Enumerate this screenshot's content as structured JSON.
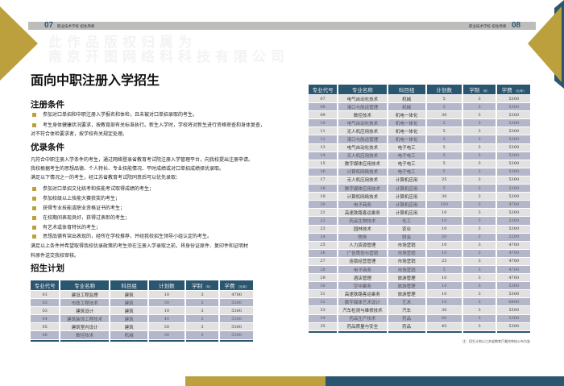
{
  "header": {
    "left_page": "07",
    "right_page": "08",
    "school": "职业技术学校  招生简章"
  },
  "watermark": [
    "此作品版权归属为",
    "南京开图网络科科技有限公司"
  ],
  "title": "面向中职注册入学招生",
  "registration": {
    "heading": "注册条件",
    "bullets": [
      "参加对口单招和中职注册入学报名和体检，且未被对口单招录取的考生。",
      "考生身体健康状况要求，按教育部有关标准执行。新生入学时，学校将对新生进行资格审查和身体复查，"
    ],
    "continuation": "对不符合体检要求者，按学校有关规定处理。"
  },
  "priority": {
    "heading": "优录条件",
    "intro": [
      "凡符合中职注册入学条件的考生，通过网络登录省教育考试院注册入学管理平台，向我校提出注册申请。",
      "我校根据考生的思想品德、个人特长、专业技能情况、平时成绩或对口单招成绩择优录取。",
      "满足以下情况之一的考生，经江苏省教育考试院同意后可以优先录取："
    ],
    "bullets": [
      "参加对口单招文化统考和技能考试取得成绩的考生；",
      "参加校级以上技能大赛获奖的考生；",
      "获得专业技能或职业资格证书的考生；",
      "在校期间表现良好，获得过表彰的考生；",
      "有艺术或体育特长的考生；",
      "思想品德有突出表现的，经所在学校推荐，并经我校招生领导小组认定的考生。"
    ],
    "closing": [
      "满足以上条件并希望取得我校优录政策的考生须在注册入学录取之前，将身份证原件、复印件和证明材",
      "料原件送交我校审核。"
    ]
  },
  "plan": {
    "heading": "招生计划"
  },
  "table_headers": [
    "专业代号",
    "专业名称",
    "科目组",
    "计划数",
    "学制",
    "学费"
  ],
  "table_header_units": [
    "",
    "",
    "",
    "",
    "（年）",
    "（元/年）"
  ],
  "table_left": [
    [
      "01",
      "建设工程监理",
      "建筑",
      "10",
      "3",
      "4700"
    ],
    [
      "02",
      "市政工程技术",
      "建筑",
      "30",
      "3",
      "5300"
    ],
    [
      "03",
      "建筑设计",
      "建筑",
      "10",
      "3",
      "5300"
    ],
    [
      "04",
      "建筑装饰工程技术",
      "建筑",
      "40",
      "3",
      "5300"
    ],
    [
      "05",
      "建筑室内设计",
      "建筑",
      "30",
      "3",
      "5300"
    ],
    [
      "06",
      "数控技术",
      "机械",
      "30",
      "3",
      "5300"
    ]
  ],
  "table_right": [
    [
      "07",
      "电气自动化技术",
      "机械",
      "5",
      "3",
      "5300"
    ],
    [
      "08",
      "港口与航运管理",
      "机械",
      "5",
      "3",
      "5300"
    ],
    [
      "09",
      "数控技术",
      "机电一体化",
      "30",
      "3",
      "5300"
    ],
    [
      "10",
      "电气自动化技术",
      "机电一体化",
      "5",
      "3",
      "5300"
    ],
    [
      "11",
      "无人机应用技术",
      "机电一体化",
      "5",
      "3",
      "5300"
    ],
    [
      "12",
      "港口与航运管理",
      "机电一体化",
      "5",
      "3",
      "5300"
    ],
    [
      "13",
      "电气自动化技术",
      "电子电工",
      "5",
      "3",
      "5300"
    ],
    [
      "14",
      "无人机应用技术",
      "电子电工",
      "5",
      "3",
      "5300"
    ],
    [
      "15",
      "数字媒体应用技术",
      "电子电工",
      "5",
      "3",
      "5300"
    ],
    [
      "16",
      "计算机网络技术",
      "电子电工",
      "5",
      "3",
      "5300"
    ],
    [
      "17",
      "无人机应用技术",
      "计算机应用",
      "25",
      "3",
      "5300"
    ],
    [
      "18",
      "数字媒体应用技术",
      "计算机应用",
      "5",
      "3",
      "5300"
    ],
    [
      "19",
      "计算机网络技术",
      "计算机应用",
      "30",
      "3",
      "5300"
    ],
    [
      "20",
      "电子商务",
      "计算机应用",
      "150",
      "3",
      "4700"
    ],
    [
      "21",
      "高速铁路客运乘务",
      "计算机应用",
      "10",
      "3",
      "5300"
    ],
    [
      "22",
      "药品生物技术",
      "化工",
      "10",
      "3",
      "5300"
    ],
    [
      "23",
      "园林技术",
      "农业",
      "10",
      "3",
      "5300"
    ],
    [
      "24",
      "税务",
      "财会",
      "50",
      "3",
      "2200"
    ],
    [
      "25",
      "人力资源管理",
      "市场营销",
      "10",
      "3",
      "4700"
    ],
    [
      "26",
      "广告策划与营销",
      "市场营销",
      "10",
      "3",
      "4700"
    ],
    [
      "27",
      "连锁经营管理",
      "市场营销",
      "25",
      "3",
      "4700"
    ],
    [
      "28",
      "电子商务",
      "市场营销",
      "5",
      "3",
      "4700"
    ],
    [
      "29",
      "酒店管理",
      "旅游管理",
      "10",
      "3",
      "4700"
    ],
    [
      "30",
      "空中乘务",
      "旅游管理",
      "10",
      "3",
      "5300"
    ],
    [
      "31",
      "高速铁路客运乘务",
      "旅游管理",
      "10",
      "3",
      "5300"
    ],
    [
      "32",
      "数字媒体艺术设计",
      "艺术",
      "10",
      "3",
      "6800"
    ],
    [
      "33",
      "汽车检测与维修技术",
      "汽车",
      "30",
      "3",
      "5500"
    ],
    [
      "34",
      "药品生产技术",
      "药品",
      "40",
      "3",
      "5300"
    ],
    [
      "35",
      "药品质量与安全",
      "药品",
      "45",
      "3",
      "5300"
    ]
  ],
  "note": "注：招生计划以江苏省教育厅最终审核公布为准",
  "colors": {
    "gold": "#bca03e",
    "navy": "#2b5670",
    "gray_bar": "#bdbdbb"
  }
}
